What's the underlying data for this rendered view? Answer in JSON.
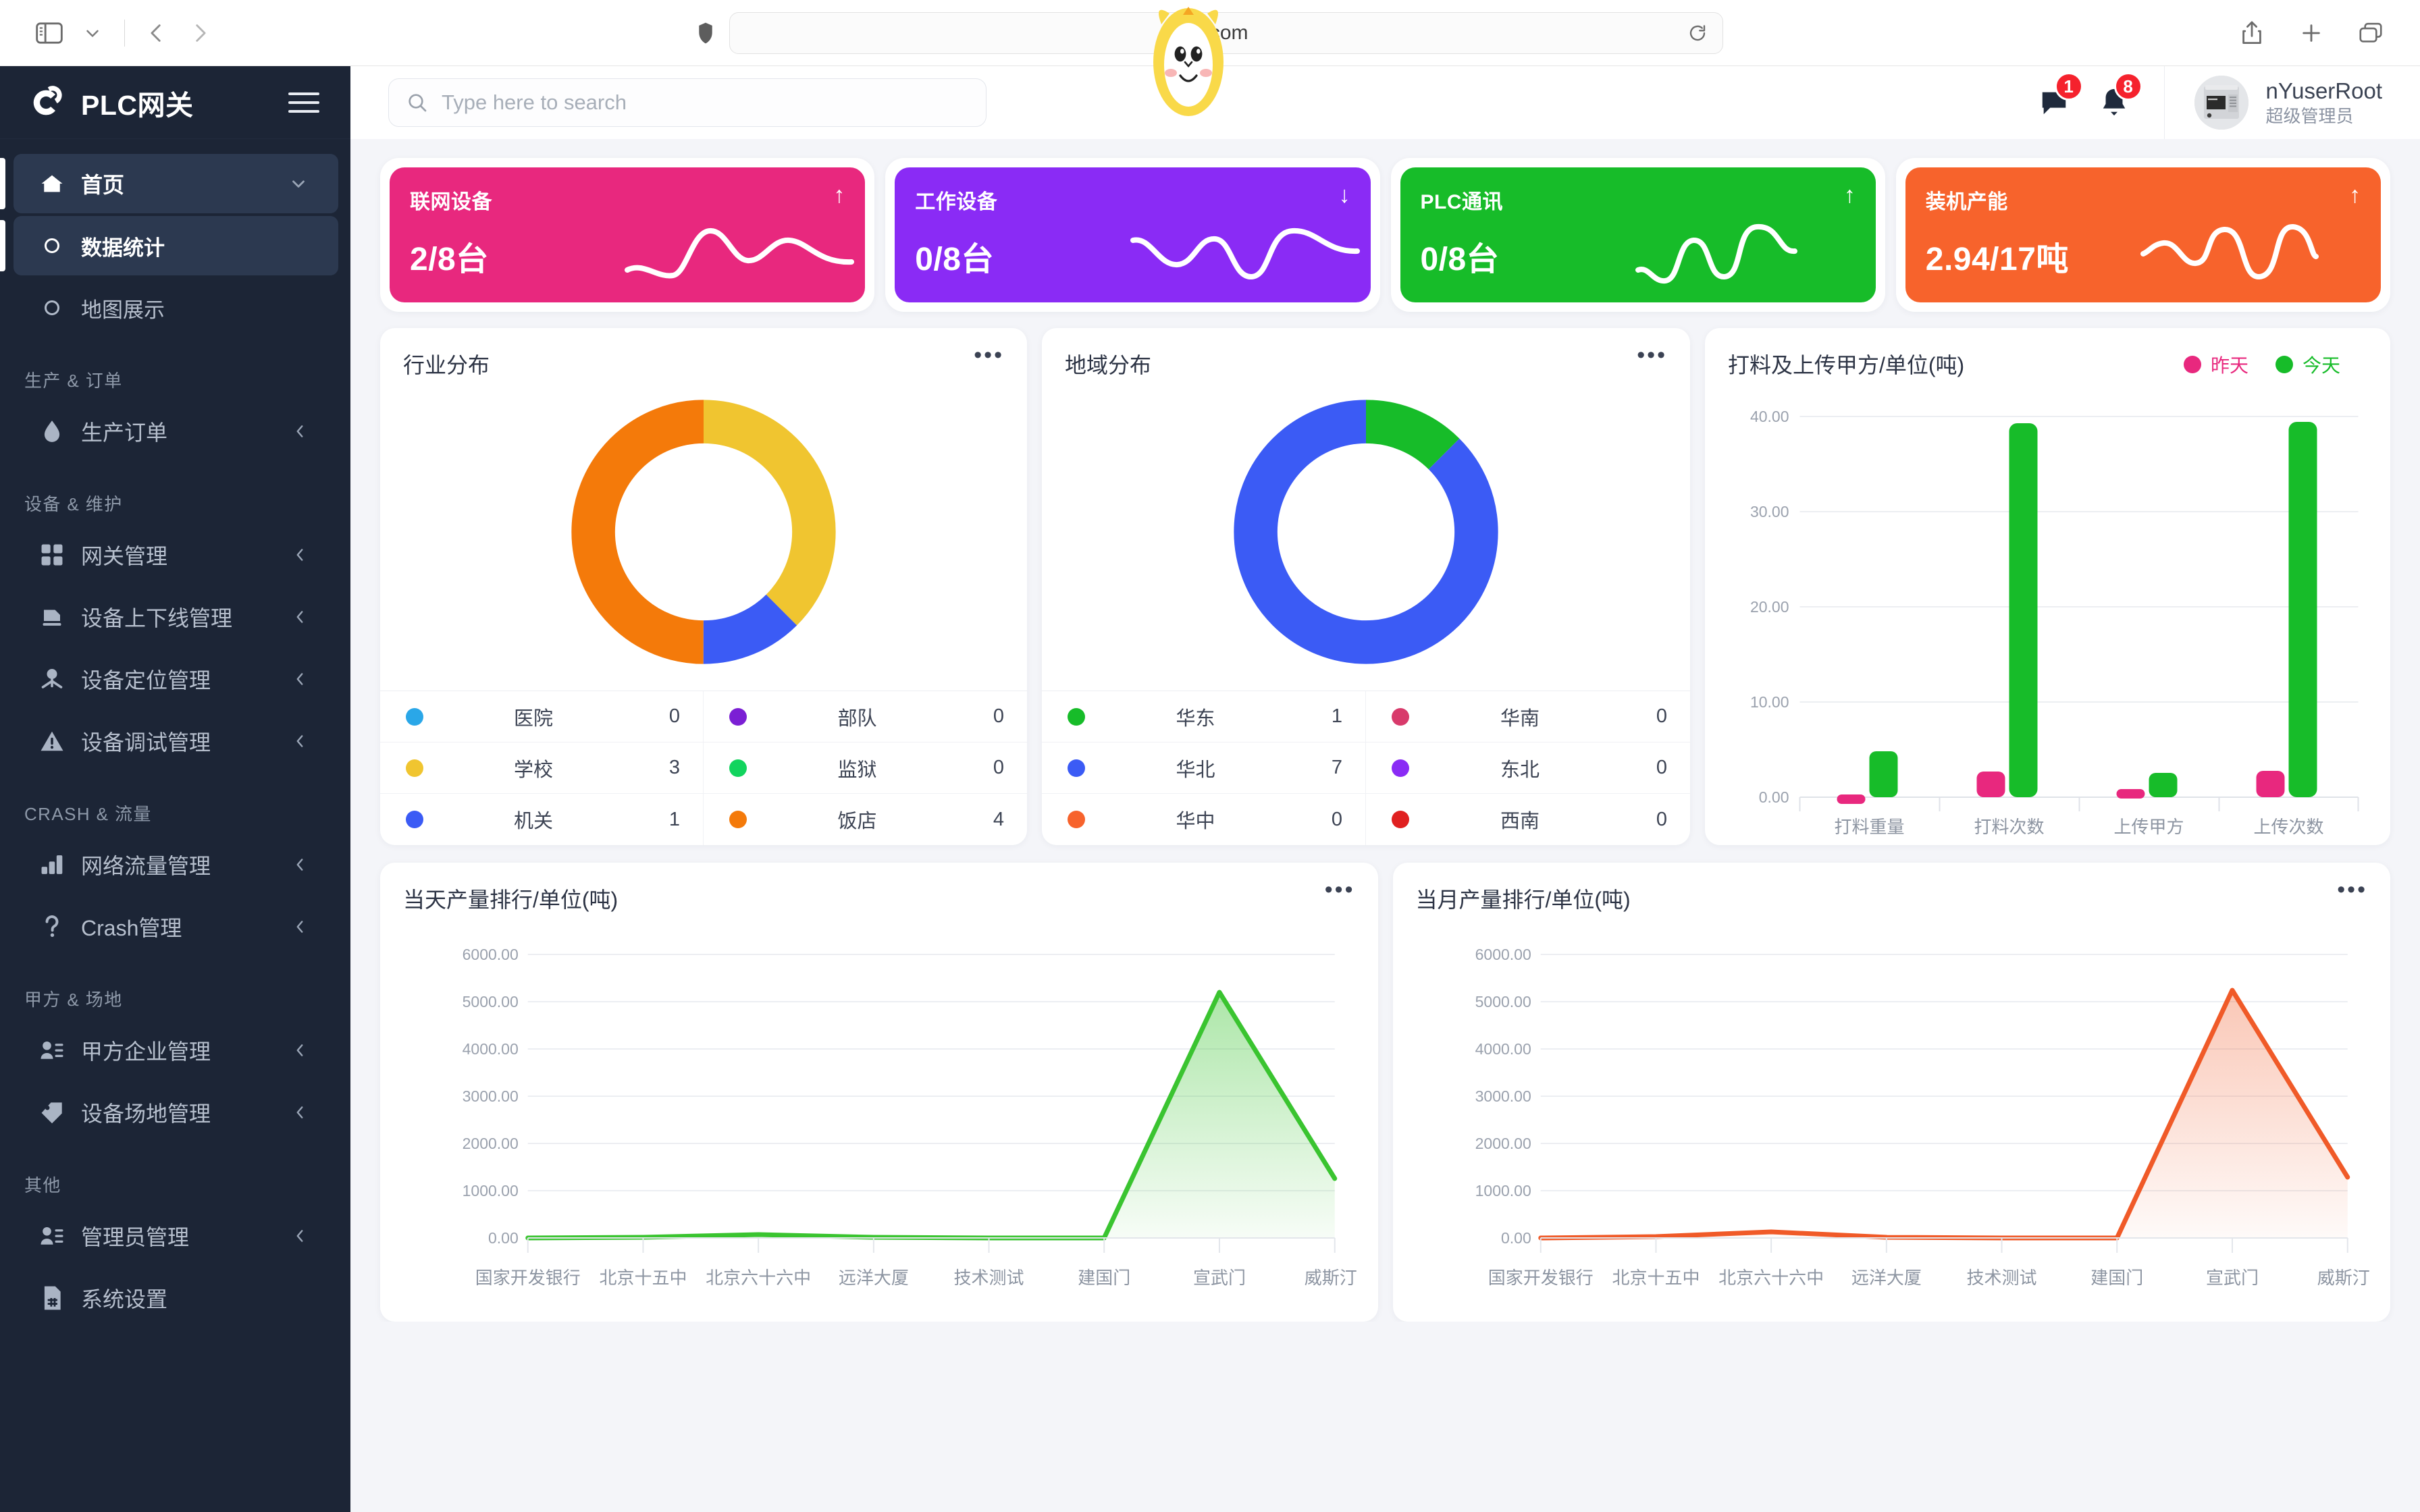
{
  "browser": {
    "url_text": ".com",
    "icons": {
      "sidebar_toggle": "sidebar-toggle-icon",
      "chevron_down": "chevron-down-icon",
      "back": "back-arrow-icon",
      "forward": "forward-arrow-icon",
      "shield": "shield-icon",
      "reload": "reload-icon",
      "share": "share-icon",
      "new_tab": "plus-icon",
      "tabs": "tabs-overview-icon"
    }
  },
  "sidebar": {
    "brand": "PLC网关",
    "items": [
      {
        "label": "首页",
        "icon": "home-icon",
        "state": "active-parent",
        "caret": "chevron-down"
      },
      {
        "label": "数据统计",
        "icon": "circle-dot-icon",
        "state": "active-child",
        "caret": ""
      },
      {
        "label": "地图展示",
        "icon": "circle-dot-icon",
        "state": "",
        "caret": ""
      }
    ],
    "groups": [
      {
        "title": "生产 & 订单",
        "items": [
          {
            "label": "生产订单",
            "icon": "droplet-icon",
            "caret": "chevron-left"
          }
        ]
      },
      {
        "title": "设备 & 维护",
        "items": [
          {
            "label": "网关管理",
            "icon": "grid-icon",
            "caret": "chevron-left"
          },
          {
            "label": "设备上下线管理",
            "icon": "document-icon",
            "caret": "chevron-left"
          },
          {
            "label": "设备定位管理",
            "icon": "pin-user-icon",
            "caret": "chevron-left"
          },
          {
            "label": "设备调试管理",
            "icon": "warning-icon",
            "caret": "chevron-left"
          }
        ]
      },
      {
        "title": "CRASH & 流量",
        "items": [
          {
            "label": "网络流量管理",
            "icon": "bar-chart-icon",
            "caret": "chevron-left"
          },
          {
            "label": "Crash管理",
            "icon": "question-icon",
            "caret": "chevron-left"
          }
        ]
      },
      {
        "title": "甲方 & 场地",
        "items": [
          {
            "label": "甲方企业管理",
            "icon": "user-list-icon",
            "caret": "chevron-left"
          },
          {
            "label": "设备场地管理",
            "icon": "tag-icon",
            "caret": "chevron-left"
          }
        ]
      },
      {
        "title": "其他",
        "items": [
          {
            "label": "管理员管理",
            "icon": "user-list-icon",
            "caret": "chevron-left"
          },
          {
            "label": "系统设置",
            "icon": "settings-doc-icon",
            "caret": ""
          }
        ]
      }
    ]
  },
  "topbar": {
    "search_placeholder": "Type here to search",
    "search_value": "",
    "messages_badge": "1",
    "notifications_badge": "8",
    "user_name": "nYuserRoot",
    "user_role": "超级管理员"
  },
  "kpis": [
    {
      "label": "联网设备",
      "value": "2/8台",
      "arrow": "↑",
      "color": "#e8287e"
    },
    {
      "label": "工作设备",
      "value": "0/8台",
      "arrow": "↓",
      "color": "#8a2bf5"
    },
    {
      "label": "PLC通讯",
      "value": "0/8台",
      "arrow": "↑",
      "color": "#17bc29"
    },
    {
      "label": "装机产能",
      "value": "2.94/17吨",
      "arrow": "↑",
      "color": "#f7632c"
    }
  ],
  "chart_data": [
    {
      "id": "industry",
      "type": "pie",
      "title": "行业分布",
      "legend_position": "bottom-table",
      "categories": [
        "医院",
        "学校",
        "机关",
        "部队",
        "监狱",
        "饭店"
      ],
      "values": [
        0,
        3,
        1,
        0,
        0,
        4
      ],
      "colors": [
        "#2aa7e8",
        "#f0c530",
        "#3b5bf5",
        "#7b1fd4",
        "#12d45e",
        "#f47a0a"
      ]
    },
    {
      "id": "region",
      "type": "pie",
      "title": "地域分布",
      "legend_position": "bottom-table",
      "categories": [
        "华东",
        "华北",
        "华中",
        "华南",
        "东北",
        "西南"
      ],
      "values": [
        1,
        7,
        0,
        0,
        0,
        0
      ],
      "colors": [
        "#17bc29",
        "#3b5bf5",
        "#f7632c",
        "#d83a6b",
        "#8a2bf5",
        "#e02020"
      ]
    },
    {
      "id": "feed-upload",
      "type": "bar",
      "title": "打料及上传甲方/单位(吨)",
      "categories": [
        "打料重量",
        "打料次数",
        "上传甲方",
        "上传次数"
      ],
      "series": [
        {
          "name": "昨天",
          "color": "#e8287e",
          "values": [
            0.25,
            2.6,
            0.2,
            2.7
          ]
        },
        {
          "name": "今天",
          "color": "#17bc29",
          "values": [
            4.7,
            38.2,
            2.5,
            38.3
          ]
        }
      ],
      "ylabel": "",
      "xlabel": "",
      "ylim": [
        0,
        40
      ],
      "yticks": [
        "0.00",
        "10.00",
        "20.00",
        "30.00",
        "40.00"
      ],
      "grid": true,
      "legend_position": "top-right"
    },
    {
      "id": "daily-output",
      "type": "area",
      "title": "当天产量排行/单位(吨)",
      "categories": [
        "国家开发银行",
        "北京十五中",
        "北京六十六中",
        "远洋大厦",
        "技术测试",
        "建国门",
        "宣武门",
        "威斯汀"
      ],
      "values": [
        0,
        20,
        70,
        20,
        0,
        0,
        5200,
        1250
      ],
      "color": "#3ac430",
      "ylim": [
        0,
        6000
      ],
      "yticks": [
        "0.00",
        "1000.00",
        "2000.00",
        "3000.00",
        "4000.00",
        "5000.00",
        "6000.00"
      ],
      "grid": true
    },
    {
      "id": "monthly-output",
      "type": "area",
      "title": "当月产量排行/单位(吨)",
      "categories": [
        "国家开发银行",
        "北京十五中",
        "北京六十六中",
        "远洋大厦",
        "技术测试",
        "建国门",
        "宣武门",
        "威斯汀"
      ],
      "values": [
        0,
        30,
        120,
        20,
        0,
        0,
        5250,
        1280
      ],
      "color": "#f05a28",
      "ylim": [
        0,
        6000
      ],
      "yticks": [
        "0.00",
        "1000.00",
        "2000.00",
        "3000.00",
        "4000.00",
        "5000.00",
        "6000.00"
      ],
      "grid": true
    }
  ],
  "cards": {
    "industry_menu": "•••",
    "region_menu": "•••",
    "daily_menu": "•••",
    "monthly_menu": "•••"
  }
}
